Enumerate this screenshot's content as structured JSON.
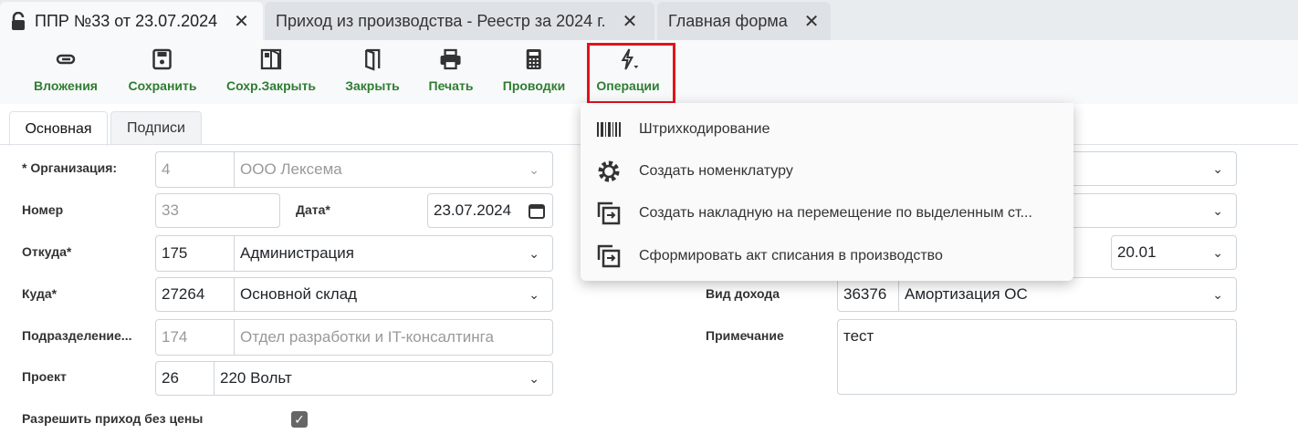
{
  "tabs": [
    {
      "label": "ППР №33 от 23.07.2024",
      "icon": "lock-open-icon",
      "active": true
    },
    {
      "label": "Приход из производства - Реестр за 2024 г."
    },
    {
      "label": "Главная форма"
    }
  ],
  "toolbar": [
    {
      "label": "Вложения",
      "icon": "paperclip-icon"
    },
    {
      "label": "Сохранить",
      "icon": "save-icon"
    },
    {
      "label": "Сохр.Закрыть",
      "icon": "save-close-icon"
    },
    {
      "label": "Закрыть",
      "icon": "door-icon"
    },
    {
      "label": "Печать",
      "icon": "printer-icon"
    },
    {
      "label": "Проводки",
      "icon": "calculator-icon"
    },
    {
      "label": "Операции",
      "icon": "lightning-dropdown-icon"
    }
  ],
  "colors": {
    "toolbar_label": "#2e7d32",
    "highlight": "#e3131b"
  },
  "inner_tabs": [
    "Основная",
    "Подписи"
  ],
  "form": {
    "org_label": "* Организация:",
    "org_code": "4",
    "org_name": "ООО Лексема",
    "number_label": "Номер",
    "number": "33",
    "date_label": "Дата*",
    "date": "23.07.2024",
    "from_label": "Откуда*",
    "from_code": "175",
    "from_name": "Администрация",
    "to_label": "Куда*",
    "to_code": "27264",
    "to_name": "Основной склад",
    "dept_label": "Подразделение...",
    "dept_code": "174",
    "dept_name": "Отдел разработки и IT-консалтинга",
    "project_label": "Проект",
    "project_code": "26",
    "project_name": "220 Вольт",
    "allow_label": "Разрешить приход без цены",
    "allow_checked": true,
    "account": "20.01",
    "income_label": "Вид дохода",
    "income_code": "36376",
    "income_name": "Амортизация ОС",
    "note_label": "Примечание",
    "note": "тест"
  },
  "menu": [
    {
      "label": "Штрихкодирование",
      "icon": "barcode-icon"
    },
    {
      "label": "Создать номенклатуру",
      "icon": "gear-icon"
    },
    {
      "label": "Создать накладную на перемещение по выделенным ст...",
      "icon": "copy-icon"
    },
    {
      "label": "Сформировать акт списания в производство",
      "icon": "copy-icon"
    }
  ]
}
